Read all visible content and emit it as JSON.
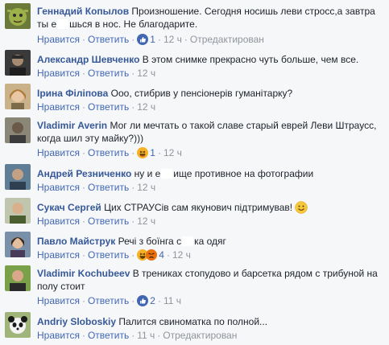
{
  "labels": {
    "like": "Нравится",
    "reply": "Ответить",
    "dot": "·",
    "edited": "Отредактирован"
  },
  "comments": [
    {
      "author": "Геннадий Копылов",
      "text_a": "Произношение. Сегодня носишь леви стросс,а завтра ты е",
      "text_b": "шься в нос. Не благодарите.",
      "reactions": [
        "like"
      ],
      "count": "1",
      "time": "12 ч",
      "edited": true
    },
    {
      "author": "Александр Шевченко",
      "text": "В этом снимке прекрасно чуть больше, чем все.",
      "time": "12 ч"
    },
    {
      "author": "Ірина Філіпова",
      "text": "Ооо, стибрив у пенсіонерів гуманітарку?",
      "time": "12 ч"
    },
    {
      "author": "Vladimir Averin",
      "text": "Мог ли мечтать о такой славе старый еврей Леви Штраусс, когда шил эту майку?)))",
      "reactions": [
        "haha"
      ],
      "count": "1",
      "time": "12 ч"
    },
    {
      "author": "Андрей Резниченко",
      "text_a": "ну и е",
      "text_b": "ище противное на фотографии",
      "time": "12 ч"
    },
    {
      "author": "Сукач Сергей",
      "text": "Цих СТРАУСів сам якунович підтримував!",
      "emoji": "smile",
      "time": "12 ч"
    },
    {
      "author": "Павло Майструк",
      "text_a": "Речі з боїнга с",
      "text_b": "ка одяг",
      "reactions": [
        "haha",
        "angry"
      ],
      "count": "4",
      "time": "12 ч"
    },
    {
      "author": "Vladimir Kochubeev",
      "text": "В трениках стопудово и барсетка рядом с трибуной на полу стоит",
      "reactions": [
        "like"
      ],
      "count": "2",
      "time": "11 ч"
    },
    {
      "author": "Andriy Sloboskiy",
      "text": "Палится свиноматка по полной...",
      "time": "11 ч",
      "edited": true
    }
  ],
  "colors": {
    "author": "#365899",
    "link": "#4267b2",
    "meta": "#90949c",
    "background": "#f6f7f9",
    "like_blue": "#4267b2",
    "haha_yellow": "#f7b125",
    "angry_orange": "#e9710f"
  },
  "avatar_icons": [
    "shrek-avatar-icon",
    "man-avatar-icon",
    "woman-avatar-icon",
    "man-avatar-icon",
    "man-avatar-icon",
    "man-avatar-icon",
    "woman-avatar-icon",
    "man-avatar-icon",
    "panda-avatar-icon"
  ]
}
